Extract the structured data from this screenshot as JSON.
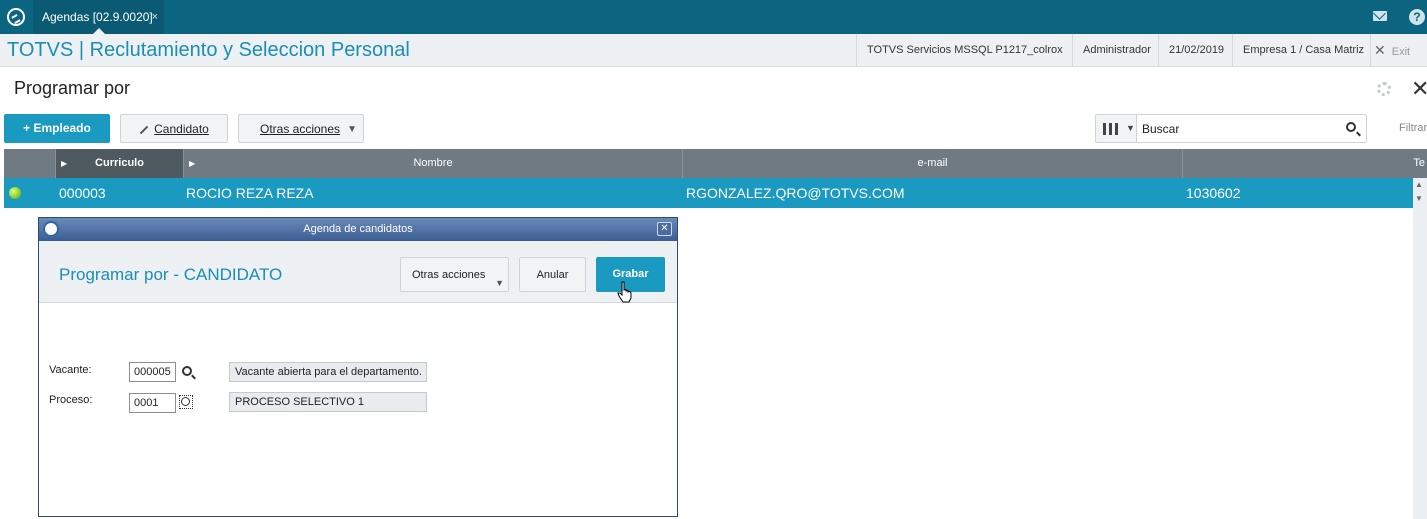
{
  "topbar": {
    "tab_label": "Agendas [02.9.0020]",
    "tab_close": "×"
  },
  "header": {
    "app_title": "TOTVS | Reclutamiento y Seleccion Personal",
    "environment": "TOTVS Servicios MSSQL P1217_colrox",
    "user": "Administrador",
    "date": "21/02/2019",
    "company": "Empresa 1 / Casa Matriz",
    "exit_label": "Exit"
  },
  "page": {
    "title": "Programar por"
  },
  "toolbar": {
    "empleado_label": "+ Empleado",
    "candidato_label": "Candidato",
    "otras_label": "Otras acciones",
    "search_placeholder": "Buscar",
    "filter_label": "Filtrar"
  },
  "grid": {
    "columns": [
      "Curriculo",
      "Nombre",
      "e-mail",
      "Te"
    ],
    "row": {
      "curriculo": "000003",
      "nombre": "ROCIO REZA REZA",
      "email": "RGONZALEZ.QRO@TOTVS.COM",
      "telefono": "1030602"
    }
  },
  "dialog": {
    "title": "Agenda de candidatos",
    "heading": "Programar por - CANDIDATO",
    "otras_label": "Otras acciones",
    "anular_label": "Anular",
    "grabar_label": "Grabar",
    "fields": {
      "vacante_label": "Vacante:",
      "vacante_value": "000005",
      "vacante_desc": "Vacante abierta para el departamento.",
      "proceso_label": "Proceso:",
      "proceso_value": "0001",
      "proceso_desc": "PROCESO SELECTIVO 1"
    }
  },
  "colors": {
    "topbar": "#0b6580",
    "accent": "#1a9ac0",
    "title_blue": "#1a8eb5",
    "grid_header": "#707a82"
  }
}
